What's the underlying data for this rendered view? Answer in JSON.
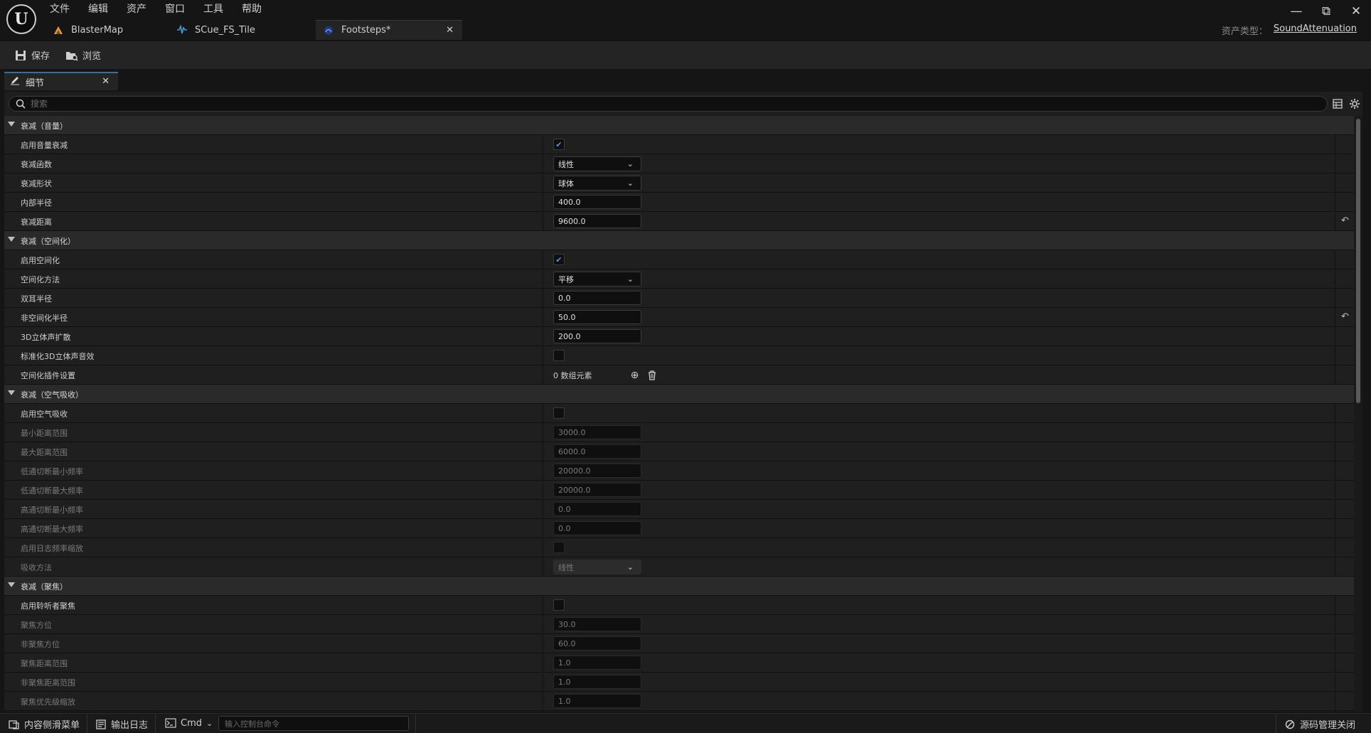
{
  "menu": [
    "文件",
    "编辑",
    "资产",
    "窗口",
    "工具",
    "帮助"
  ],
  "window_controls": {
    "minimize": "—",
    "restore": "⧉",
    "close": "✕"
  },
  "doc_tabs": [
    {
      "label": "BlasterMap",
      "icon": "level-icon",
      "icon_color": "#e89a2e"
    },
    {
      "label": "SCue_FS_Tile",
      "icon": "sound-cue-icon",
      "icon_color": "#3aa0d8"
    },
    {
      "label": "Footsteps*",
      "icon": "sound-attenuation-icon",
      "icon_color": "#3a6fd8"
    }
  ],
  "asset_type": {
    "label": "资产类型：",
    "value": "SoundAttenuation"
  },
  "toolbar": {
    "save_label": "保存",
    "browse_label": "浏览"
  },
  "panel_tab": {
    "label": "细节"
  },
  "search": {
    "placeholder": "搜索"
  },
  "sections": [
    {
      "title": "衰减（音量）",
      "rows": [
        {
          "name": "启用音量衰减",
          "type": "check",
          "checked": true,
          "dim": false
        },
        {
          "name": "衰减函数",
          "type": "combo",
          "value": "线性",
          "dim": false
        },
        {
          "name": "衰减形状",
          "type": "combo",
          "value": "球体",
          "dim": false
        },
        {
          "name": "内部半径",
          "type": "num",
          "value": "400.0",
          "dim": false
        },
        {
          "name": "衰减距离",
          "type": "num",
          "value": "9600.0",
          "dim": false,
          "reset": true
        }
      ]
    },
    {
      "title": "衰减（空间化）",
      "rows": [
        {
          "name": "启用空间化",
          "type": "check",
          "checked": true,
          "dim": false
        },
        {
          "name": "空间化方法",
          "type": "combo",
          "value": "平移",
          "dim": false
        },
        {
          "name": "双耳半径",
          "type": "num",
          "value": "0.0",
          "dim": false
        },
        {
          "name": "非空间化半径",
          "type": "num",
          "value": "50.0",
          "dim": false,
          "reset": true
        },
        {
          "name": "3D立体声扩散",
          "type": "num",
          "value": "200.0",
          "dim": false
        },
        {
          "name": "标准化3D立体声音效",
          "type": "check",
          "checked": false,
          "dim": false
        },
        {
          "name": "空间化插件设置",
          "type": "array",
          "value": "0 数组元素",
          "dim": false
        }
      ]
    },
    {
      "title": "衰减（空气吸收）",
      "rows": [
        {
          "name": "启用空气吸收",
          "type": "check",
          "checked": false,
          "dim": false
        },
        {
          "name": "最小距离范围",
          "type": "num",
          "value": "3000.0",
          "dim": true
        },
        {
          "name": "最大距离范围",
          "type": "num",
          "value": "6000.0",
          "dim": true
        },
        {
          "name": "低通切断最小频率",
          "type": "num",
          "value": "20000.0",
          "dim": true
        },
        {
          "name": "低通切断最大频率",
          "type": "num",
          "value": "20000.0",
          "dim": true
        },
        {
          "name": "高通切断最小频率",
          "type": "num",
          "value": "0.0",
          "dim": true
        },
        {
          "name": "高通切断最大频率",
          "type": "num",
          "value": "0.0",
          "dim": true
        },
        {
          "name": "启用日志频率缩放",
          "type": "check",
          "checked": false,
          "dim": true
        },
        {
          "name": "吸收方法",
          "type": "combo",
          "value": "线性",
          "dim": true
        }
      ]
    },
    {
      "title": "衰减（聚焦）",
      "rows": [
        {
          "name": "启用聆听者聚焦",
          "type": "check",
          "checked": false,
          "dim": false
        },
        {
          "name": "聚焦方位",
          "type": "num",
          "value": "30.0",
          "dim": true
        },
        {
          "name": "非聚焦方位",
          "type": "num",
          "value": "60.0",
          "dim": true
        },
        {
          "name": "聚焦距离范围",
          "type": "num",
          "value": "1.0",
          "dim": true
        },
        {
          "name": "非聚焦距离范围",
          "type": "num",
          "value": "1.0",
          "dim": true
        },
        {
          "name": "聚焦优先级缩放",
          "type": "num",
          "value": "1.0",
          "dim": true
        }
      ]
    }
  ],
  "statusbar": {
    "content_drawer": "内容侧滑菜单",
    "output_log": "输出日志",
    "cmd": "Cmd",
    "cmd_placeholder": "输入控制台命令",
    "source_control": "源码管理关闭"
  }
}
